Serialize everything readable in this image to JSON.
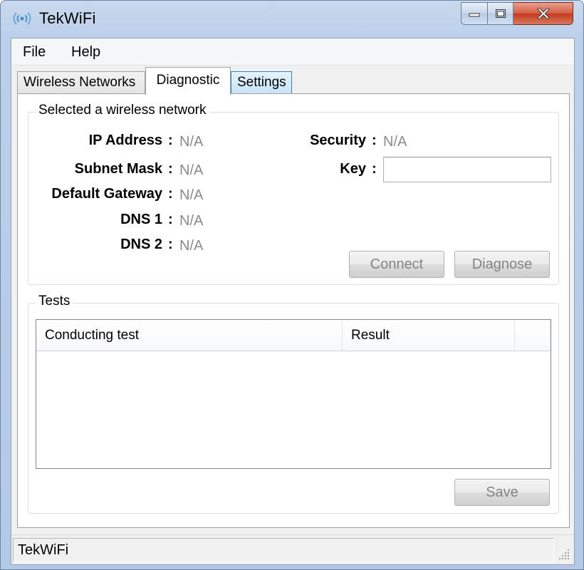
{
  "window": {
    "title": "TekWiFi"
  },
  "menu": {
    "file": "File",
    "help": "Help"
  },
  "tabs": [
    {
      "label": "Wireless Networks",
      "active": false
    },
    {
      "label": "Diagnostic",
      "active": true
    },
    {
      "label": "Settings",
      "active": false
    }
  ],
  "network_group": {
    "title": "Selected a wireless network",
    "fields": {
      "ip_address": {
        "label": "IP Address",
        "value": "N/A"
      },
      "subnet_mask": {
        "label": "Subnet Mask",
        "value": "N/A"
      },
      "default_gateway": {
        "label": "Default Gateway",
        "value": "N/A"
      },
      "dns1": {
        "label": "DNS 1",
        "value": "N/A"
      },
      "dns2": {
        "label": "DNS 2",
        "value": "N/A"
      },
      "security": {
        "label": "Security",
        "value": "N/A"
      },
      "key": {
        "label": "Key",
        "value": ""
      }
    },
    "colon": ":",
    "connect_label": "Connect",
    "diagnose_label": "Diagnose"
  },
  "tests_group": {
    "title": "Tests",
    "columns": [
      "Conducting test",
      "Result",
      ""
    ],
    "rows": [],
    "save_label": "Save"
  },
  "status": {
    "text": "TekWiFi"
  },
  "colors": {
    "frame": "#bcd0ea",
    "close_button": "#c3381e",
    "active_tab_settings_border": "#3c7fb1",
    "disabled_text": "#8a8a8a"
  },
  "icons": {
    "app": "wifi-signal-icon",
    "minimize": "minimize-icon",
    "maximize": "maximize-icon",
    "close": "close-icon",
    "grip": "resize-grip-icon"
  }
}
